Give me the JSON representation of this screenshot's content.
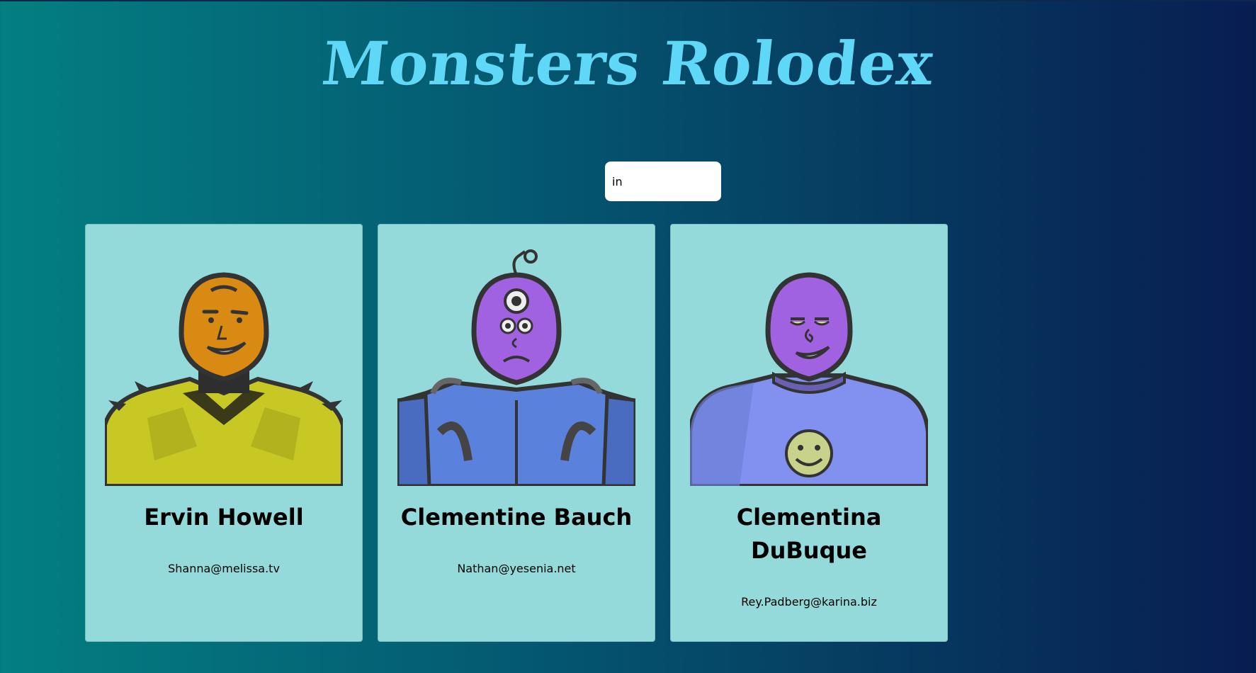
{
  "app": {
    "title": "Monsters Rolodex"
  },
  "search": {
    "value": "in"
  },
  "monsters": [
    {
      "name": "Ervin Howell",
      "email": "Shanna@melissa.tv",
      "avatar": "yellow-spiky-monster",
      "skin": "#d88a12",
      "suit": "#c8c824"
    },
    {
      "name": "Clementine Bauch",
      "email": "Nathan@yesenia.net",
      "avatar": "cyclops-robot-monster",
      "skin": "#a062e0",
      "suit": "#5a82dc"
    },
    {
      "name": "Clementina DuBuque",
      "email": "Rey.Padberg@karina.biz",
      "avatar": "smiley-shirt-monster",
      "skin": "#a062e0",
      "suit": "#8290f0"
    }
  ],
  "colors": {
    "title": "#5fd7f7",
    "card_bg": "#95dada"
  }
}
